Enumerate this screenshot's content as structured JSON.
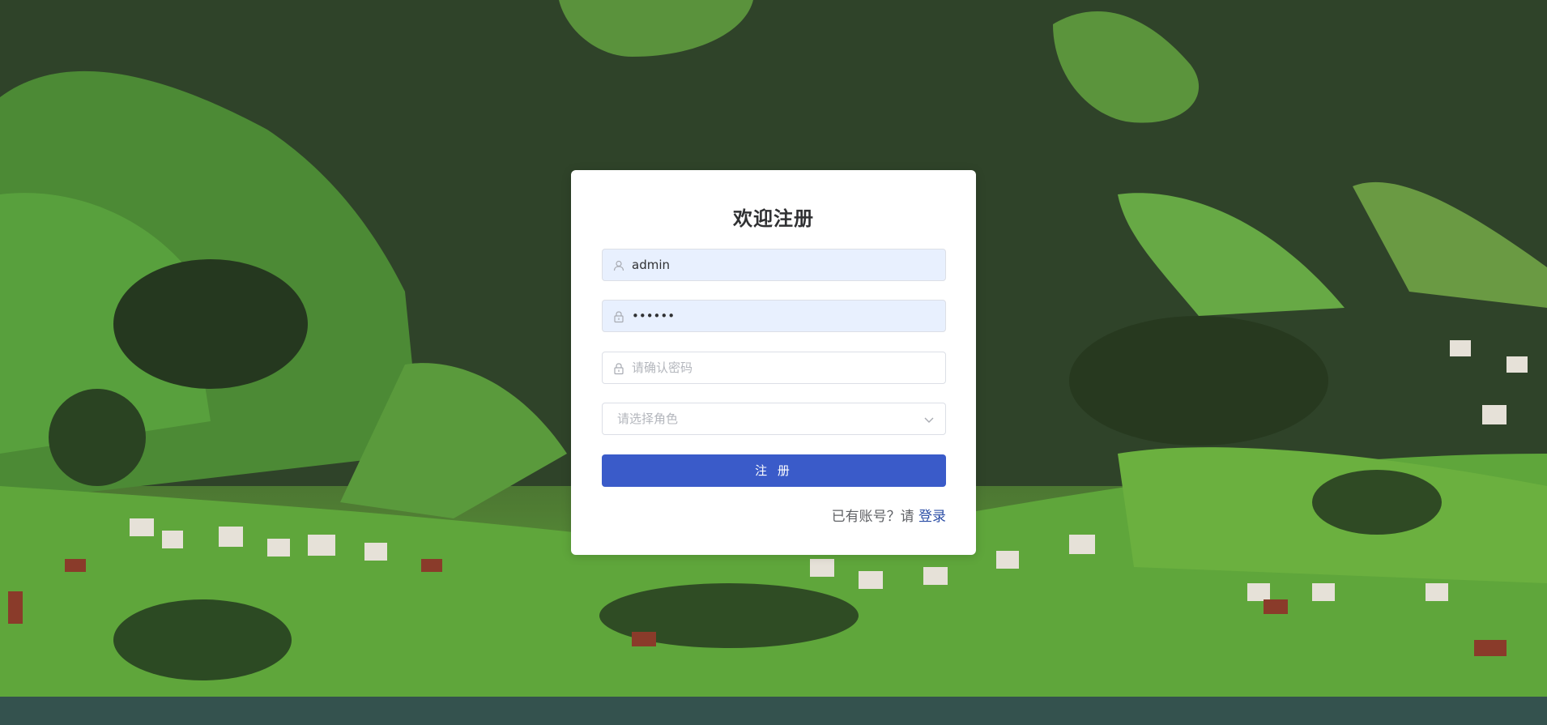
{
  "page": {
    "background": "mountain-village-landscape",
    "colors": {
      "accent": "#3a5bc9",
      "link": "#2d4fa6",
      "autofill": "#e8f0fe"
    }
  },
  "register": {
    "title": "欢迎注册",
    "username": {
      "value": "admin",
      "icon": "user-icon"
    },
    "password": {
      "value": "••••••",
      "icon": "lock-icon"
    },
    "confirm_password": {
      "placeholder": "请确认密码",
      "icon": "lock-icon"
    },
    "role": {
      "placeholder": "请选择角色",
      "icon": "chevron-down-icon"
    },
    "submit_label": "注 册",
    "footer_text": "已有账号？请",
    "login_link": "登录"
  }
}
